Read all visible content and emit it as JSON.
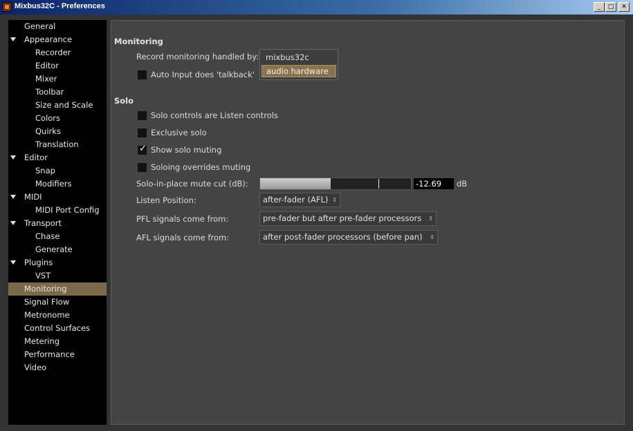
{
  "window": {
    "title": "Mixbus32C - Preferences"
  },
  "sidebar": {
    "items": [
      {
        "label": "General"
      },
      {
        "label": "Appearance"
      },
      {
        "label": "Recorder"
      },
      {
        "label": "Editor"
      },
      {
        "label": "Mixer"
      },
      {
        "label": "Toolbar"
      },
      {
        "label": "Size and Scale"
      },
      {
        "label": "Colors"
      },
      {
        "label": "Quirks"
      },
      {
        "label": "Translation"
      },
      {
        "label": "Editor"
      },
      {
        "label": "Snap"
      },
      {
        "label": "Modifiers"
      },
      {
        "label": "MIDI"
      },
      {
        "label": "MIDI Port Config"
      },
      {
        "label": "Transport"
      },
      {
        "label": "Chase"
      },
      {
        "label": "Generate"
      },
      {
        "label": "Plugins"
      },
      {
        "label": "VST"
      },
      {
        "label": "Monitoring"
      },
      {
        "label": "Signal Flow"
      },
      {
        "label": "Metronome"
      },
      {
        "label": "Control Surfaces"
      },
      {
        "label": "Metering"
      },
      {
        "label": "Performance"
      },
      {
        "label": "Video"
      }
    ],
    "selected": "Monitoring"
  },
  "monitoring": {
    "heading": "Monitoring",
    "record_label": "Record monitoring handled by:",
    "record_options": [
      "mixbus32c",
      "audio hardware"
    ],
    "record_selected": "audio hardware",
    "auto_input_label": "Auto Input does 'talkback'",
    "auto_input_checked": false
  },
  "solo": {
    "heading": "Solo",
    "listen_controls_label": "Solo controls are Listen controls",
    "listen_controls_checked": false,
    "exclusive_label": "Exclusive solo",
    "exclusive_checked": false,
    "show_muting_label": "Show solo muting",
    "show_muting_checked": true,
    "overrides_label": "Soloing overrides muting",
    "overrides_checked": false,
    "mute_cut_label": "Solo-in-place mute cut (dB):",
    "mute_cut_value": "-12.69",
    "mute_cut_fill": 0.47,
    "mute_cut_unit": "dB",
    "listen_position_label": "Listen Position:",
    "listen_position_value": "after-fader (AFL)",
    "pfl_label": "PFL signals come from:",
    "pfl_value": "pre-fader but after pre-fader processors",
    "afl_label": "AFL signals come from:",
    "afl_value": "after post-fader processors (before pan)"
  },
  "icons": {
    "check": "✓",
    "combo_arrow": "⌃⌄"
  },
  "colors": {
    "selection": "#7a6a4a",
    "popup_highlight": "#8a7450"
  }
}
